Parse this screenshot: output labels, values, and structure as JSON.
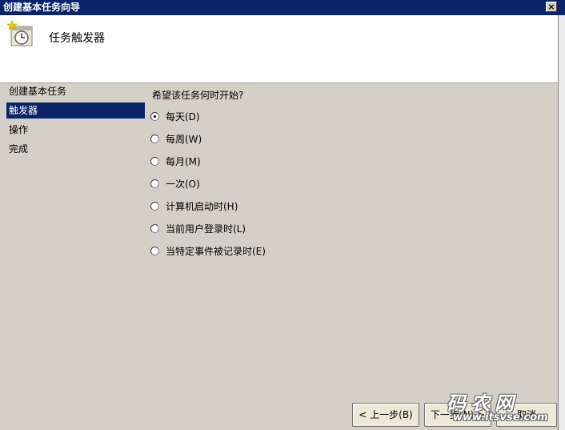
{
  "window": {
    "title": "创建基本任务向导",
    "close_glyph": "×"
  },
  "header": {
    "title": "任务触发器"
  },
  "steps": [
    {
      "label": "创建基本任务",
      "active": false
    },
    {
      "label": "触发器",
      "active": true
    },
    {
      "label": "操作",
      "active": false
    },
    {
      "label": "完成",
      "active": false
    }
  ],
  "form": {
    "question": "希望该任务何时开始?",
    "options": [
      {
        "label": "每天(D)",
        "checked": true
      },
      {
        "label": "每周(W)",
        "checked": false
      },
      {
        "label": "每月(M)",
        "checked": false
      },
      {
        "label": "一次(O)",
        "checked": false
      },
      {
        "label": "计算机启动时(H)",
        "checked": false
      },
      {
        "label": "当前用户登录时(L)",
        "checked": false
      },
      {
        "label": "当特定事件被记录时(E)",
        "checked": false
      }
    ]
  },
  "buttons": {
    "back": "< 上一步(B)",
    "next": "下一步(N) >",
    "cancel": "取消"
  },
  "watermark": {
    "text": "码农网",
    "url": "www.itsvse.com"
  },
  "colors": {
    "titlebar": "#0a246a",
    "selection": "#0a246a",
    "dialog": "#d4d0c8"
  }
}
